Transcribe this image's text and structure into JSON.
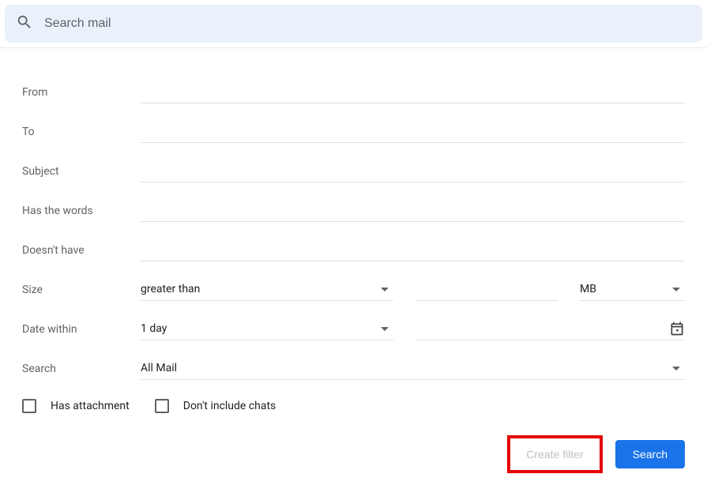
{
  "searchBar": {
    "placeholder": "Search mail"
  },
  "labels": {
    "from": "From",
    "to": "To",
    "subject": "Subject",
    "hasWords": "Has the words",
    "doesntHave": "Doesn't have",
    "size": "Size",
    "dateWithin": "Date within",
    "search": "Search"
  },
  "values": {
    "sizeOp": "greater than",
    "sizeUnit": "MB",
    "dateRange": "1 day",
    "searchScope": "All Mail"
  },
  "checkboxes": {
    "hasAttachment": "Has attachment",
    "excludeChats": "Don't include chats"
  },
  "buttons": {
    "createFilter": "Create filter",
    "search": "Search"
  }
}
